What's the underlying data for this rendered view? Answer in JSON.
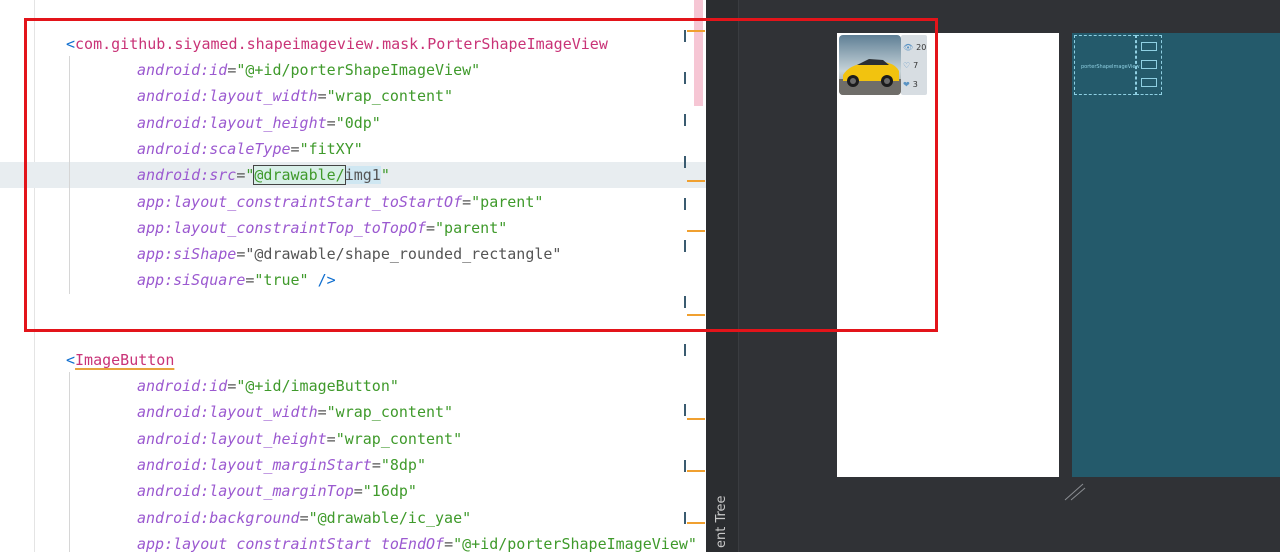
{
  "editor": {
    "block1": {
      "tag_open": "<",
      "tag_name": "com.github.siyamed.shapeimageview.mask.PorterShapeImageView",
      "lines": [
        {
          "ns": "android",
          "attr": "id",
          "value": "\"@+id/porterShapeImageView\""
        },
        {
          "ns": "android",
          "attr": "layout_width",
          "value": "\"wrap_content\""
        },
        {
          "ns": "android",
          "attr": "layout_height",
          "value": "\"0dp\""
        },
        {
          "ns": "android",
          "attr": "scaleType",
          "value": "\"fitXY\""
        },
        {
          "ns": "android",
          "attr": "src",
          "value_prefix": "\"",
          "value_part1": "@drawable/",
          "value_part2": "img1",
          "value_suffix": "\""
        },
        {
          "ns": "app",
          "attr": "layout_constraintStart_toStartOf",
          "value": "\"parent\""
        },
        {
          "ns": "app",
          "attr": "layout_constraintTop_toTopOf",
          "value": "\"parent\""
        },
        {
          "ns": "app",
          "attr": "siShape",
          "value": "\"@drawable/shape_rounded_rectangle\""
        },
        {
          "ns": "app",
          "attr": "siSquare",
          "value": "\"true\"",
          "close": " />"
        }
      ]
    },
    "block2": {
      "tag_open": "<",
      "tag_name": "ImageButton",
      "lines": [
        {
          "ns": "android",
          "attr": "id",
          "value": "\"@+id/imageButton\""
        },
        {
          "ns": "android",
          "attr": "layout_width",
          "value": "\"wrap_content\""
        },
        {
          "ns": "android",
          "attr": "layout_height",
          "value": "\"wrap_content\""
        },
        {
          "ns": "android",
          "attr": "layout_marginStart",
          "value": "\"8dp\""
        },
        {
          "ns": "android",
          "attr": "layout_marginTop",
          "value": "\"16dp\""
        },
        {
          "ns": "android",
          "attr": "background",
          "value": "\"@drawable/ic_yae\""
        },
        {
          "ns": "app",
          "attr": "layout_constraintStart_toEndOf",
          "value": "\"@+id/porterShapeImageView\""
        }
      ]
    }
  },
  "designer": {
    "side_panel_label": "ent Tree",
    "preview_icons": [
      {
        "icon": "eye-icon",
        "count": "20"
      },
      {
        "icon": "heart-icon",
        "count": "7"
      },
      {
        "icon": "like-icon",
        "count": "3"
      }
    ],
    "blueprint_label": "porterShapeImageView"
  },
  "colors": {
    "highlight_box": "#e3141a",
    "tag": "#c93377",
    "attr": "#b88a12",
    "namespace": "#9b59d0",
    "value": "#3f9a2b",
    "blueprint": "#245a6b"
  }
}
